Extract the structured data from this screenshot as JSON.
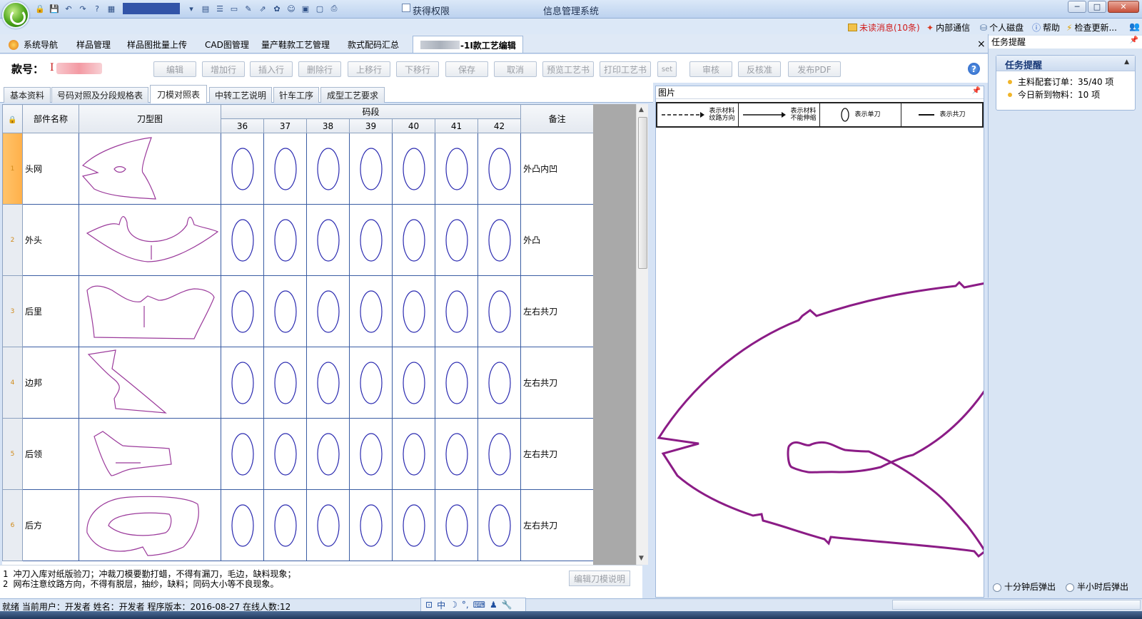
{
  "window": {
    "title": "信息管理系统",
    "permission_label": "获得权限",
    "buttons": {
      "minimize": "─",
      "maximize": "□",
      "close": "✕"
    }
  },
  "notifications": {
    "unread": "未读消息(10条)",
    "internal": "内部通信",
    "disk": "个人磁盘",
    "help": "帮助",
    "update": "检查更新..."
  },
  "modules": {
    "items": [
      "系统导航",
      "样品管理",
      "样品图批量上传",
      "CAD图管理",
      "量产鞋款工艺管理",
      "款式配码汇总"
    ],
    "active_suffix": "-1I款工艺编辑",
    "close": "×"
  },
  "toolbar": {
    "code_label": "款号：",
    "code_value": "I              -1I",
    "buttons": [
      "编辑",
      "增加行",
      "插入行",
      "删除行",
      "上移行",
      "下移行",
      "保存",
      "取消",
      "预览工艺书",
      "打印工艺书",
      "set",
      "审核",
      "反核准",
      "发布PDF"
    ],
    "help": "?"
  },
  "sub_tabs": {
    "items": [
      "基本资料",
      "号码对照及分段规格表",
      "刀模对照表",
      "中转工艺说明",
      "针车工序",
      "成型工艺要求"
    ],
    "active_index": 2
  },
  "grid": {
    "headers": {
      "part_name": "部件名称",
      "knife_image": "刀型图",
      "size_group": "码段",
      "remark": "备注"
    },
    "sizes": [
      "36",
      "37",
      "38",
      "39",
      "40",
      "41",
      "42"
    ],
    "rows": [
      {
        "num": "1",
        "name": "头网",
        "remark": "外凸内凹",
        "shape": "head-mesh"
      },
      {
        "num": "2",
        "name": "外头",
        "remark": "外凸",
        "shape": "outer-toe"
      },
      {
        "num": "3",
        "name": "后里",
        "remark": "左右共刀",
        "shape": "back-lining"
      },
      {
        "num": "4",
        "name": "边邦",
        "remark": "左右共刀",
        "shape": "side-panel"
      },
      {
        "num": "5",
        "name": "后领",
        "remark": "左右共刀",
        "shape": "back-collar"
      },
      {
        "num": "6",
        "name": "后方",
        "remark": "左右共刀",
        "shape": "heel-counter"
      }
    ],
    "selected_row": 0,
    "colors": {
      "outline": "#9b3a9b",
      "oval": "#2a2ab0",
      "grid_line": "#3a5da3"
    }
  },
  "notes": {
    "line1": "1 冲刀入库对纸版验刀；冲裁刀模要勤打蜡，不得有漏刀，毛边，缺料现象；",
    "line2": "2 网布注意纹路方向，不得有脱层，抽纱，缺料；同码大小等不良现象。",
    "edit_button": "编辑刀模说明"
  },
  "picture_panel": {
    "title": "图片",
    "legend": [
      {
        "text1": "表示材料",
        "text2": "纹路方向",
        "icon": "dashed-arrow"
      },
      {
        "text1": "表示材料",
        "text2": "不能伸缩",
        "icon": "solid-arrow"
      },
      {
        "text1": "表示单刀",
        "text2": "",
        "icon": "oval"
      },
      {
        "text1": "表示共刀",
        "text2": "",
        "icon": "line"
      }
    ],
    "outline_color": "#8b1c86"
  },
  "task_panel": {
    "title": "任务提醒",
    "box_title": "任务提醒",
    "items": [
      "主料配套订单：35/40 项",
      "今日新到物料：10 项"
    ],
    "radio1": "十分钟后弹出",
    "radio2": "半小时后弹出"
  },
  "statusbar": {
    "text": "就绪  当前用户：开发者  姓名：开发者  程序版本：2016-08-27  在线人数:12",
    "ime": {
      "mode": "中"
    }
  }
}
